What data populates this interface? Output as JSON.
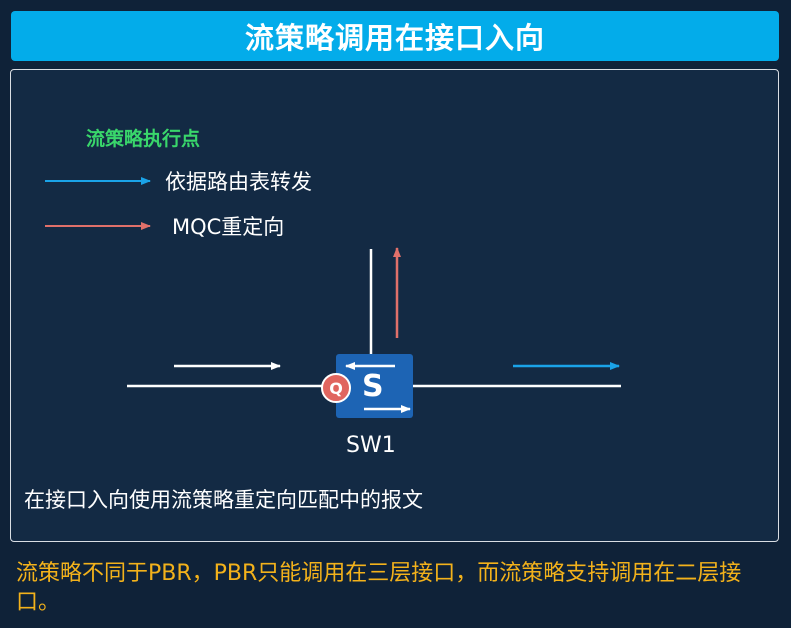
{
  "header": {
    "title": "流策略调用在接口入向"
  },
  "legend": {
    "title": "流策略执行点",
    "items": [
      {
        "label": "依据路由表转发",
        "color": "#1aa3e8"
      },
      {
        "label": "MQC重定向",
        "color": "#e0706a"
      }
    ]
  },
  "device": {
    "name": "SW1",
    "symbol": "S",
    "badge": "Q",
    "icon": "switch-icon"
  },
  "caption": "在接口入向使用流策略重定向匹配中的报文",
  "footer": "流策略不同于PBR，PBR只能调用在三层接口，而流策略支持调用在二层接口。",
  "colors": {
    "title_bg": "#03acea",
    "background": "#0f2238",
    "legend_title": "#39d66b",
    "forward_arrow": "#1aa3e8",
    "redirect_arrow": "#e0706a",
    "switch": "#1d64b4",
    "footer_text": "#f3b21b"
  }
}
